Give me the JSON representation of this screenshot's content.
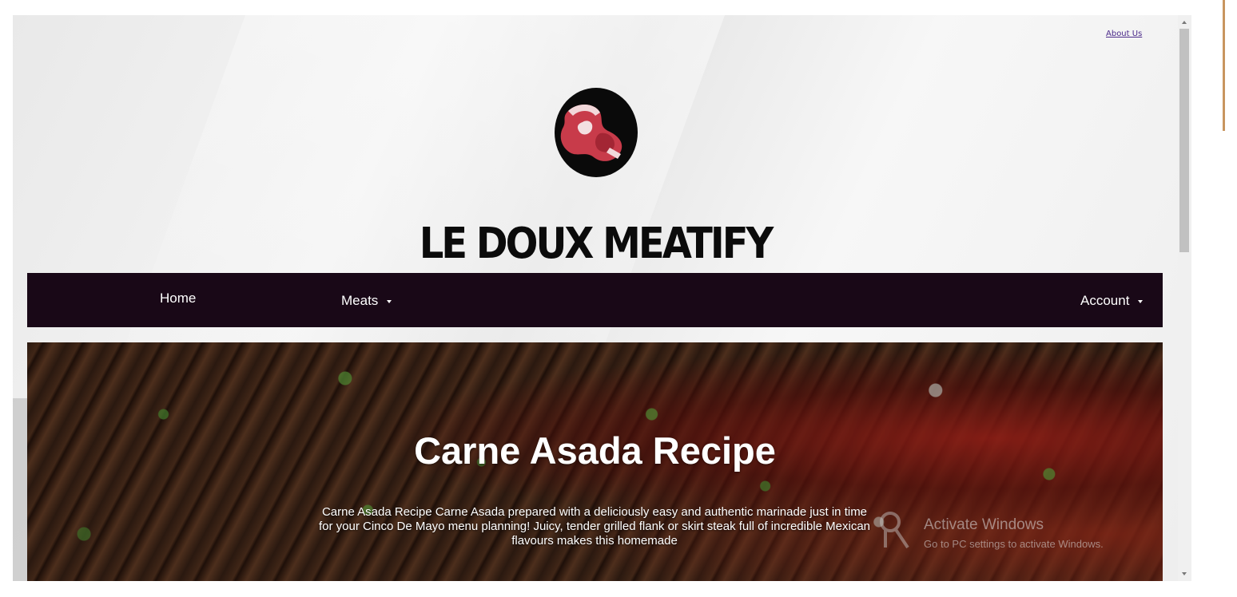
{
  "header": {
    "about_link": "About Us",
    "site_title": "LE DOUX MEATIFY",
    "logo_icon": "steak-logo-icon"
  },
  "nav": {
    "home": "Home",
    "meats": "Meats",
    "account": "Account"
  },
  "hero": {
    "title": "Carne Asada Recipe",
    "description": "Carne Asada Recipe Carne Asada prepared with a deliciously easy and authentic marinade just in time for your Cinco De Mayo menu planning! Juicy, tender grilled flank or skirt steak full of incredible Mexican flavours makes this homemade"
  },
  "watermark": {
    "title": "Activate Windows",
    "subtitle": "Go to PC settings to activate Windows.",
    "icon": "key-icon"
  },
  "colors": {
    "navbar": "#190817",
    "title_text": "#0b0b0b",
    "link": "#4b2a8a",
    "accent_edge": "#c8955f"
  }
}
